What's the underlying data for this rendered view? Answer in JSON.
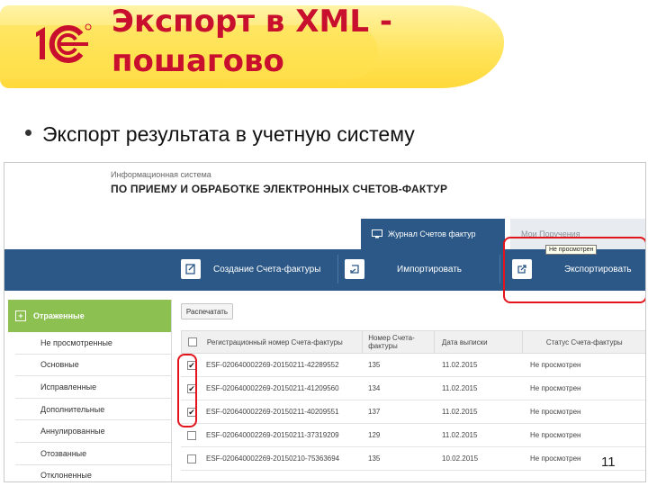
{
  "slide": {
    "title_line1": "Экспорт в XML -",
    "title_line2": "пошагово",
    "bullet": "Экспорт результата в учетную систему",
    "page_number": "11"
  },
  "app": {
    "subtitle": "Информационная система",
    "title": "ПО ПРИЕМУ И ОБРАБОТКЕ ЭЛЕКТРОННЫХ СЧЕТОВ-ФАКТУР"
  },
  "tabs": [
    {
      "label": "Журнал Счетов фактур"
    },
    {
      "label": "Мои Поручения"
    }
  ],
  "toolbar": {
    "create_label": "Создание Счета-фактуры",
    "import_label": "Импортировать",
    "export_label": "Экспортировать"
  },
  "sidebar": {
    "header": "Отраженные",
    "items": [
      {
        "label": "Не просмотренные"
      },
      {
        "label": "Основные"
      },
      {
        "label": "Исправленные"
      },
      {
        "label": "Дополнительные"
      },
      {
        "label": "Аннулированные"
      },
      {
        "label": "Отозванные"
      },
      {
        "label": "Отклоненные"
      }
    ]
  },
  "grid": {
    "refresh_label": "Распечатать",
    "columns": [
      "Регистрационный номер Счета-фактуры",
      "Номер Счета-фактуры",
      "Дата выписки",
      "Статус Счета-фактуры"
    ],
    "rows": [
      {
        "checked": "✔",
        "reg": "ESF-020640002269-20150211-42289552",
        "num": "135",
        "date": "11.02.2015",
        "status": "Не просмотрен"
      },
      {
        "checked": "✔",
        "reg": "ESF-020640002269-20150211-41209560",
        "num": "134",
        "date": "11.02.2015",
        "status": "Не просмотрен"
      },
      {
        "checked": "✔",
        "reg": "ESF-020640002269-20150211-40209551",
        "num": "137",
        "date": "11.02.2015",
        "status": "Не просмотрен"
      },
      {
        "checked": "",
        "reg": "ESF-020640002269-20150211-37319209",
        "num": "129",
        "date": "11.02.2015",
        "status": "Не просмотрен"
      },
      {
        "checked": "",
        "reg": "ESF-020640002269-20150210-75363694",
        "num": "135",
        "date": "10.02.2015",
        "status": "Не просмотрен"
      }
    ],
    "tooltip": "Не просмотрен"
  },
  "colors": {
    "title_red": "#c8102e",
    "nav_blue": "#2b5887",
    "sidebar_green": "#8cc152",
    "highlight_red": "#e3141b",
    "banner_yellow": "#ffe14f"
  }
}
